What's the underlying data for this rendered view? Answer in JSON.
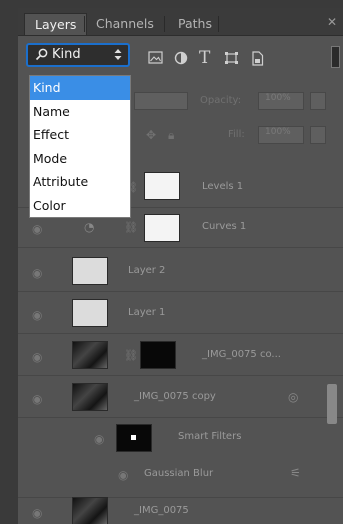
{
  "tabs": [
    {
      "label": "Layers",
      "active": true
    },
    {
      "label": "Channels",
      "active": false
    },
    {
      "label": "Paths",
      "active": false
    }
  ],
  "filter": {
    "selected": "Kind",
    "icons": [
      "image-filter-icon",
      "adjustment-filter-icon",
      "type-filter-icon",
      "shape-filter-icon",
      "smart-object-filter-icon"
    ]
  },
  "opacity_label": "Opacity:",
  "opacity_value": "100%",
  "fill_label": "Fill:",
  "fill_value": "100%",
  "dropdown": {
    "options": [
      "Kind",
      "Name",
      "Effect",
      "Mode",
      "Attribute",
      "Color"
    ],
    "selected_index": 0
  },
  "layers": [
    {
      "name": "Levels 1",
      "thumb": "white"
    },
    {
      "name": "Curves 1",
      "thumb": "white"
    },
    {
      "name": "Layer 2",
      "thumb": "light"
    },
    {
      "name": "Layer 1",
      "thumb": "light"
    },
    {
      "name": "_IMG_0075 co...",
      "thumb": "photo"
    },
    {
      "name": "_IMG_0075 copy",
      "thumb": "photo"
    },
    {
      "name": "Smart Filters",
      "thumb": "black"
    },
    {
      "name": "Gaussian Blur",
      "thumb": "none"
    },
    {
      "name": "_IMG_0075",
      "thumb": "photo"
    }
  ],
  "colors": {
    "accent": "#1b6fcc",
    "highlight": "#3a8ee6",
    "panel": "#535353"
  }
}
